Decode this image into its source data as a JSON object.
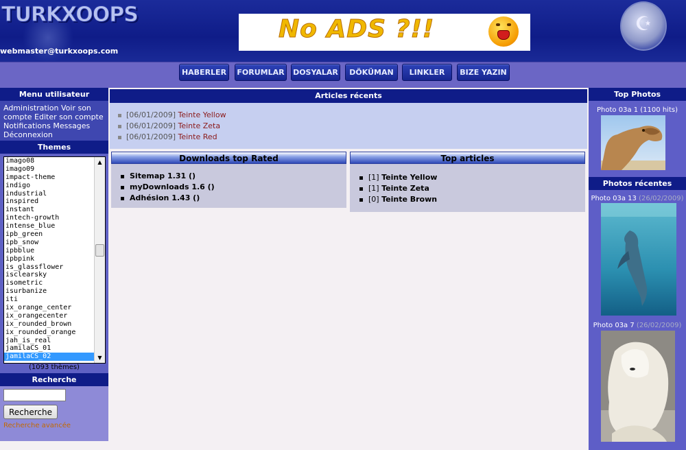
{
  "header": {
    "logo_text": "TURKXOOPS",
    "webmaster": "webmaster@turkxoops.com",
    "banner_text": "No ADS ?!!"
  },
  "nav": {
    "items": [
      "HABERLER",
      "FORUMLAR",
      "DOSYALAR",
      "DÖKÜMAN",
      "LINKLER",
      "BIZE YAZIN"
    ]
  },
  "user_menu": {
    "title": "Menu utilisateur",
    "text": "Administration Voir son compte Editer son compte Notifications Messages Déconnexion"
  },
  "themes": {
    "title": "Themes",
    "items": [
      "imago08",
      "imago09",
      "impact-theme",
      "indigo",
      "industrial",
      "inspired",
      "instant",
      "intech-growth",
      "intense_blue",
      "ipb_green",
      "ipb_snow",
      "ipbblue",
      "ipbpink",
      "is_glassflower",
      "isclearsky",
      "isometric",
      "isurbanize",
      "iti",
      "ix_orange_center",
      "ix_orangecenter",
      "ix_rounded_brown",
      "ix_rounded_orange",
      "jah_is_real",
      "jamilaCS_01",
      "jamilaCS_02"
    ],
    "selected": "jamilaCS_02",
    "count": "(1093 thèmes)"
  },
  "search": {
    "title": "Recherche",
    "button_label": "Recherche",
    "advanced_label": "Recherche avancée",
    "value": ""
  },
  "recent_articles": {
    "title": "Articles récents",
    "items": [
      {
        "date": "[06/01/2009]",
        "title": "Teinte Yellow"
      },
      {
        "date": "[06/01/2009]",
        "title": "Teinte Zeta"
      },
      {
        "date": "[06/01/2009]",
        "title": "Teinte Red"
      }
    ]
  },
  "downloads": {
    "title": "Downloads top Rated",
    "items": [
      "Sitemap 1.31 ()",
      "myDownloads 1.6 ()",
      "Adhésion 1.43 ()"
    ]
  },
  "top_articles": {
    "title": "Top articles",
    "items": [
      {
        "count": "[1]",
        "title": "Teinte Yellow"
      },
      {
        "count": "[1]",
        "title": "Teinte Zeta"
      },
      {
        "count": "[0]",
        "title": "Teinte Brown"
      }
    ]
  },
  "top_photos": {
    "title": "Top Photos",
    "items": [
      {
        "caption": "Photo 03a 1 (1100 hits)",
        "subject": "camel"
      }
    ]
  },
  "recent_photos": {
    "title": "Photos récentes",
    "items": [
      {
        "caption": "Photo 03a 13",
        "date": "(26/02/2009)",
        "subject": "dolphin"
      },
      {
        "caption": "Photo 03a 7",
        "date": "(26/02/2009)",
        "subject": "polar-bear"
      }
    ]
  }
}
